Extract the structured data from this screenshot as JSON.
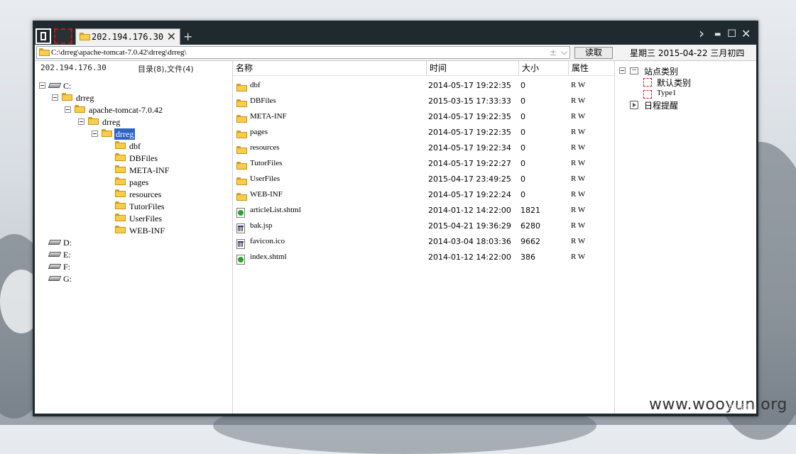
{
  "window": {
    "tab_title": "202.194.176.30",
    "tab_close_glyph": "✕",
    "new_tab_glyph": "+"
  },
  "controls": {
    "nav_glyph": "›",
    "min_glyph": "▬",
    "max_glyph": "◻",
    "close_glyph": "✕"
  },
  "address": {
    "path": "C:\\drreg\\apache-tomcat-7.0.42\\drreg\\drreg\\",
    "plus_glyph": "±",
    "dropdown_glyph": "⌵",
    "read_button": "读取",
    "date": "星期三 2015-04-22 三月初四"
  },
  "left": {
    "host": "202.194.176.30",
    "counts": "目录(8),文件(4)",
    "tree": {
      "c": "C:",
      "drreg1": "drreg",
      "tomcat": "apache-tomcat-7.0.42",
      "drreg2": "drreg",
      "drreg3": "drreg",
      "children": [
        "dbf",
        "DBFiles",
        "META-INF",
        "pages",
        "resources",
        "TutorFiles",
        "UserFiles",
        "WEB-INF"
      ],
      "d": "D:",
      "e": "E:",
      "f": "F:",
      "g": "G:"
    }
  },
  "files": {
    "headers": {
      "name": "名称",
      "time": "时间",
      "size": "大小",
      "attr": "属性"
    },
    "rows": [
      {
        "name": "dbf",
        "time": "2014-05-17 19:22:35",
        "size": "0",
        "attr": "R W",
        "icon": "folder"
      },
      {
        "name": "DBFiles",
        "time": "2015-03-15 17:33:33",
        "size": "0",
        "attr": "R W",
        "icon": "folder"
      },
      {
        "name": "META-INF",
        "time": "2014-05-17 19:22:35",
        "size": "0",
        "attr": "R W",
        "icon": "folder"
      },
      {
        "name": "pages",
        "time": "2014-05-17 19:22:35",
        "size": "0",
        "attr": "R W",
        "icon": "folder"
      },
      {
        "name": "resources",
        "time": "2014-05-17 19:22:34",
        "size": "0",
        "attr": "R W",
        "icon": "folder"
      },
      {
        "name": "TutorFiles",
        "time": "2014-05-17 19:22:27",
        "size": "0",
        "attr": "R W",
        "icon": "folder"
      },
      {
        "name": "UserFiles",
        "time": "2015-04-17 23:49:25",
        "size": "0",
        "attr": "R W",
        "icon": "folder"
      },
      {
        "name": "WEB-INF",
        "time": "2014-05-17 19:22:24",
        "size": "0",
        "attr": "R W",
        "icon": "folder"
      },
      {
        "name": "articleList.shtml",
        "time": "2014-01-12 14:22:00",
        "size": "1821",
        "attr": "R W",
        "icon": "html-file"
      },
      {
        "name": "bak.jsp",
        "time": "2015-04-21 19:36:29",
        "size": "6280",
        "attr": "R W",
        "icon": "app-file"
      },
      {
        "name": "favicon.ico",
        "time": "2014-03-04 18:03:36",
        "size": "9662",
        "attr": "R W",
        "icon": "app-file"
      },
      {
        "name": "index.shtml",
        "time": "2014-01-12 14:22:00",
        "size": "386",
        "attr": "R W",
        "icon": "html-file"
      }
    ]
  },
  "right": {
    "site_category": "站点类别",
    "default_category": "默认类别",
    "type1": "Type1",
    "schedule": "日程提醒"
  },
  "watermark": "www.wooyun.org",
  "watermark_small": "8862822"
}
